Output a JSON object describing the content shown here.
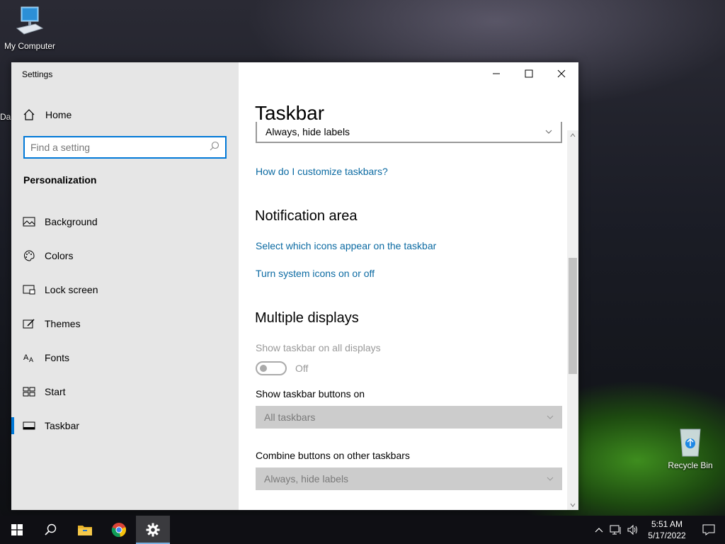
{
  "desktop": {
    "my_computer_label": "My Computer",
    "recycle_bin_label": "Recycle Bin",
    "partial_label": "Da"
  },
  "window": {
    "app_title": "Settings",
    "home_label": "Home",
    "search_placeholder": "Find a setting",
    "section_title": "Personalization",
    "nav_items": [
      {
        "label": "Background",
        "icon": "picture-icon"
      },
      {
        "label": "Colors",
        "icon": "palette-icon"
      },
      {
        "label": "Lock screen",
        "icon": "lock-screen-icon"
      },
      {
        "label": "Themes",
        "icon": "themes-icon"
      },
      {
        "label": "Fonts",
        "icon": "fonts-icon"
      },
      {
        "label": "Start",
        "icon": "start-icon"
      },
      {
        "label": "Taskbar",
        "icon": "taskbar-icon",
        "selected": true
      }
    ]
  },
  "content": {
    "page_title": "Taskbar",
    "combine_buttons_value": "Always, hide labels",
    "customize_link": "How do I customize taskbars?",
    "notification_heading": "Notification area",
    "select_icons_link": "Select which icons appear on the taskbar",
    "system_icons_link": "Turn system icons on or off",
    "multiple_displays_heading": "Multiple displays",
    "show_all_displays_label": "Show taskbar on all displays",
    "show_all_displays_state": "Off",
    "show_buttons_on_label": "Show taskbar buttons on",
    "show_buttons_on_value": "All taskbars",
    "combine_other_label": "Combine buttons on other taskbars",
    "combine_other_value": "Always, hide labels"
  },
  "taskbar": {
    "time": "5:51 AM",
    "date": "5/17/2022"
  },
  "colors": {
    "accent": "#0078d7",
    "link": "#0b6aa2"
  }
}
